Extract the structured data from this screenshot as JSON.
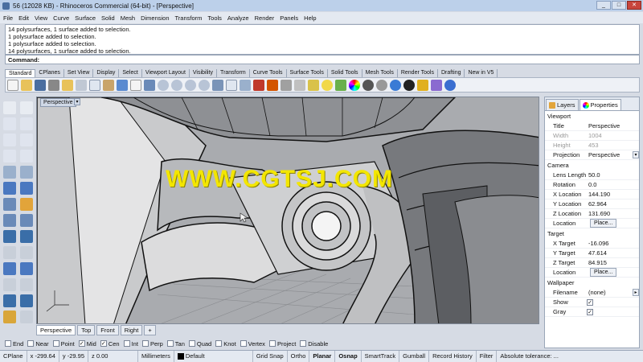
{
  "window": {
    "title": "56 (12028 KB) - Rhinoceros Commercial (64-bit) - [Perspective]",
    "btn_min": "_",
    "btn_max": "□",
    "btn_close": "✕"
  },
  "menu": [
    "File",
    "Edit",
    "View",
    "Curve",
    "Surface",
    "Solid",
    "Mesh",
    "Dimension",
    "Transform",
    "Tools",
    "Analyze",
    "Render",
    "Panels",
    "Help"
  ],
  "history": [
    "14 polysurfaces, 1 surface added to selection.",
    "1 polysurface added to selection.",
    "1 polysurface added to selection.",
    "14 polysurfaces, 1 surface added to selection."
  ],
  "command_label": "Command:",
  "toolbar_tabs": [
    "Standard",
    "CPlanes",
    "Set View",
    "Display",
    "Select",
    "Viewport Layout",
    "Visibility",
    "Transform",
    "Curve Tools",
    "Surface Tools",
    "Solid Tools",
    "Mesh Tools",
    "Render Tools",
    "Drafting",
    "New in V5"
  ],
  "toolbar_icons": [
    "new-icon",
    "open-icon",
    "save-icon",
    "print-icon",
    "import-icon",
    "cut-icon",
    "copy-icon",
    "paste-icon",
    "undo-icon",
    "redo-icon",
    "pan-icon",
    "rotate-view-icon",
    "zoom-icon",
    "zoom-window-icon",
    "zoom-extents-icon",
    "zoom-selected-icon",
    "undo-view-icon",
    "four-view-icon",
    "cplane-icon",
    "select-icon",
    "hide-icon",
    "show-icon",
    "lock-icon",
    "unlock-icon",
    "light-icon",
    "layer-icon",
    "color-wheel-icon",
    "shaded-icon",
    "rendered-icon",
    "sphere-icon",
    "material-icon",
    "car-icon",
    "help-icon"
  ],
  "viewport": {
    "label": "Perspective",
    "watermark": "WWW.CGTSJ.COM"
  },
  "viewport_tabs": [
    "Perspective",
    "Top",
    "Front",
    "Right",
    "+"
  ],
  "osnaps": [
    {
      "label": "End",
      "checked": false
    },
    {
      "label": "Near",
      "checked": false
    },
    {
      "label": "Point",
      "checked": false
    },
    {
      "label": "Mid",
      "checked": true
    },
    {
      "label": "Cen",
      "checked": true
    },
    {
      "label": "Int",
      "checked": false
    },
    {
      "label": "Perp",
      "checked": false
    },
    {
      "label": "Tan",
      "checked": false
    },
    {
      "label": "Quad",
      "checked": false
    },
    {
      "label": "Knot",
      "checked": false
    },
    {
      "label": "Vertex",
      "checked": false
    },
    {
      "label": "Project",
      "checked": false
    },
    {
      "label": "Disable",
      "checked": false
    }
  ],
  "status": {
    "cplane": "CPlane",
    "x": "x -299.64",
    "y": "y -29.95",
    "z": "z 0.00",
    "units": "Millimeters",
    "layer": "Default",
    "grid_snap": "Grid Snap",
    "ortho": "Ortho",
    "planar": "Planar",
    "osnap": "Osnap",
    "smarttrack": "SmartTrack",
    "gumball": "Gumball",
    "record_history": "Record History",
    "filter": "Filter",
    "tolerance": "Absolute tolerance: ..."
  },
  "panel": {
    "tabs": [
      {
        "label": "Layers",
        "icon": "layers-icon"
      },
      {
        "label": "Properties",
        "icon": "properties-icon"
      }
    ],
    "viewport_section": "Viewport",
    "title_k": "Title",
    "title_v": "Perspective",
    "width_k": "Width",
    "width_v": "1004",
    "height_k": "Height",
    "height_v": "453",
    "projection_k": "Projection",
    "projection_v": "Perspective",
    "camera_section": "Camera",
    "lens_k": "Lens Length",
    "lens_v": "50.0",
    "rotation_k": "Rotation",
    "rotation_v": "0.0",
    "xloc_k": "X Location",
    "xloc_v": "144.190",
    "yloc_k": "Y Location",
    "yloc_v": "62.964",
    "zloc_k": "Z Location",
    "zloc_v": "131.690",
    "location_k": "Location",
    "place": "Place...",
    "target_section": "Target",
    "xt_k": "X Target",
    "xt_v": "-16.096",
    "yt_k": "Y Target",
    "yt_v": "47.614",
    "zt_k": "Z Target",
    "zt_v": "84.915",
    "tlocation_k": "Location",
    "wallpaper_section": "Wallpaper",
    "filename_k": "Filename",
    "filename_v": "(none)",
    "show_k": "Show",
    "gray_k": "Gray",
    "check": "✓"
  },
  "colors": {
    "accent": "#bcd0ea",
    "watermark": "#f3e600"
  }
}
